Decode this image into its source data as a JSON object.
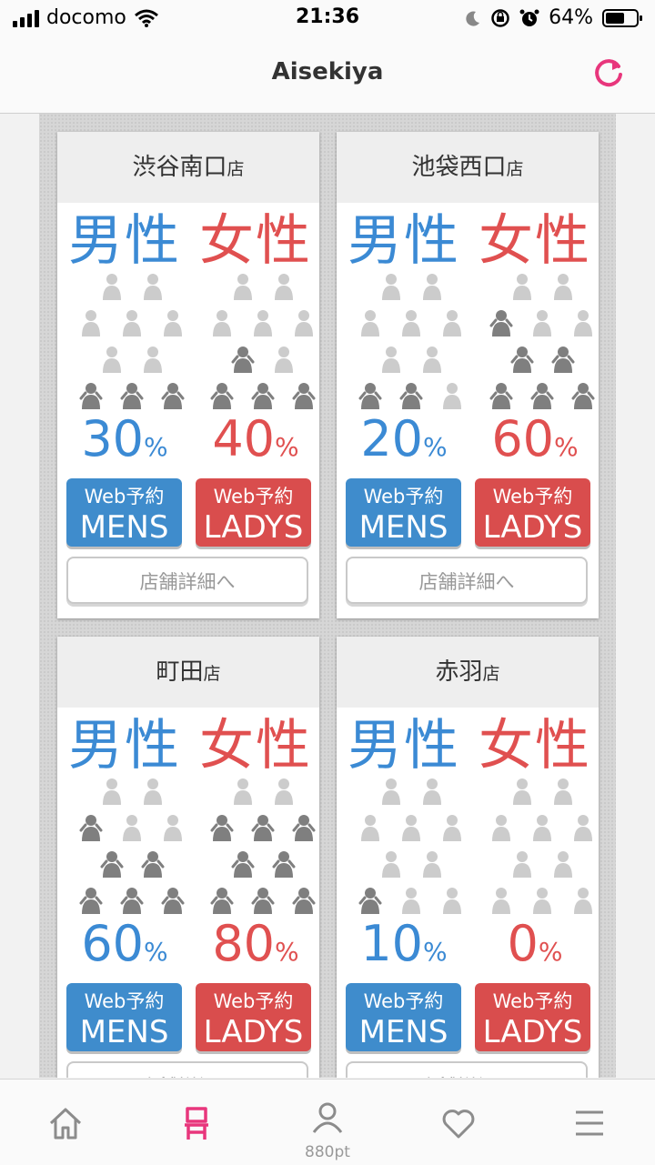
{
  "status": {
    "carrier": "docomo",
    "time": "21:36",
    "battery": "64%",
    "battery_level": 0.64
  },
  "header": {
    "title": "Aisekiya"
  },
  "labels": {
    "men": "男性",
    "women": "女性",
    "pct_sign": "%",
    "web": "Web予約",
    "mens": "MENS",
    "ladys": "LADYS",
    "detail": "店舗詳細へ"
  },
  "stores": [
    {
      "name": "渋谷南口",
      "suffix": "店",
      "men": {
        "value": "30",
        "fill": 3
      },
      "women": {
        "value": "40",
        "fill": 4
      }
    },
    {
      "name": "池袋西口",
      "suffix": "店",
      "men": {
        "value": "20",
        "fill": 2
      },
      "women": {
        "value": "60",
        "fill": 6
      }
    },
    {
      "name": "町田",
      "suffix": "店",
      "men": {
        "value": "60",
        "fill": 6
      },
      "women": {
        "value": "80",
        "fill": 8
      }
    },
    {
      "name": "赤羽",
      "suffix": "店",
      "men": {
        "value": "10",
        "fill": 1
      },
      "women": {
        "value": "0",
        "fill": 0
      }
    }
  ],
  "tabs": [
    {
      "name": "home",
      "icon": "home-icon",
      "label": ""
    },
    {
      "name": "seat",
      "icon": "chair-icon",
      "label": ""
    },
    {
      "name": "points",
      "icon": "user-icon",
      "label": "880pt"
    },
    {
      "name": "favorites",
      "icon": "heart-icon",
      "label": ""
    },
    {
      "name": "menu",
      "icon": "menu-icon",
      "label": ""
    }
  ],
  "colors": {
    "accent": "#e8367c",
    "men": "#3b8ad4",
    "women": "#e05050",
    "person_on": "#7f7f7f",
    "person_off": "#cccccc"
  }
}
